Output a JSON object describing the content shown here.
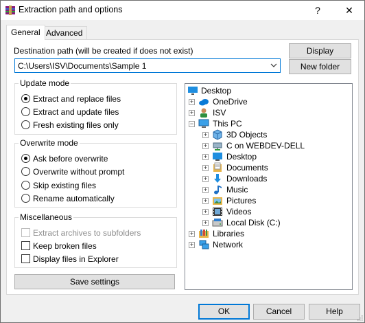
{
  "window": {
    "title": "Extraction path and options",
    "help_glyph": "?",
    "close_glyph": "✕"
  },
  "tabs": [
    {
      "label": "General"
    },
    {
      "label": "Advanced"
    }
  ],
  "general": {
    "destination_label": "Destination path (will be created if does not exist)",
    "destination_value": "C:\\Users\\ISV\\Documents\\Sample 1",
    "display_button": "Display",
    "new_folder_button": "New folder",
    "update_mode": {
      "title": "Update mode",
      "options": [
        {
          "label": "Extract and replace files",
          "checked": true
        },
        {
          "label": "Extract and update files",
          "checked": false
        },
        {
          "label": "Fresh existing files only",
          "checked": false
        }
      ]
    },
    "overwrite_mode": {
      "title": "Overwrite mode",
      "options": [
        {
          "label": "Ask before overwrite",
          "checked": true
        },
        {
          "label": "Overwrite without prompt",
          "checked": false
        },
        {
          "label": "Skip existing files",
          "checked": false
        },
        {
          "label": "Rename automatically",
          "checked": false
        }
      ]
    },
    "misc": {
      "title": "Miscellaneous",
      "options": [
        {
          "label": "Extract archives to subfolders",
          "checked": false,
          "disabled": true
        },
        {
          "label": "Keep broken files",
          "checked": false,
          "disabled": false
        },
        {
          "label": "Display files in Explorer",
          "checked": false,
          "disabled": false
        }
      ]
    },
    "save_settings_button": "Save settings",
    "tree": [
      {
        "label": "Desktop",
        "icon": "desktop-icon",
        "expander": ""
      },
      {
        "label": "OneDrive",
        "icon": "cloud-icon",
        "expander": "+"
      },
      {
        "label": "ISV",
        "icon": "user-icon",
        "expander": "+"
      },
      {
        "label": "This PC",
        "icon": "computer-icon",
        "expander": "−"
      },
      {
        "label": "3D Objects",
        "icon": "cube-icon",
        "expander": "+"
      },
      {
        "label": "C on WEBDEV-DELL",
        "icon": "network-drive-icon",
        "expander": "+"
      },
      {
        "label": "Desktop",
        "icon": "desktop-icon",
        "expander": "+"
      },
      {
        "label": "Documents",
        "icon": "document-icon",
        "expander": "+"
      },
      {
        "label": "Downloads",
        "icon": "download-icon",
        "expander": "+"
      },
      {
        "label": "Music",
        "icon": "music-icon",
        "expander": "+"
      },
      {
        "label": "Pictures",
        "icon": "picture-icon",
        "expander": "+"
      },
      {
        "label": "Videos",
        "icon": "video-icon",
        "expander": "+"
      },
      {
        "label": "Local Disk (C:)",
        "icon": "disk-icon",
        "expander": "+"
      },
      {
        "label": "Libraries",
        "icon": "library-icon",
        "expander": "+"
      },
      {
        "label": "Network",
        "icon": "network-icon",
        "expander": "+"
      }
    ]
  },
  "footer": {
    "ok": "OK",
    "cancel": "Cancel",
    "help": "Help"
  },
  "colors": {
    "accent": "#0078d7",
    "folder": "#e8b54a",
    "panel": "#ffffff"
  }
}
